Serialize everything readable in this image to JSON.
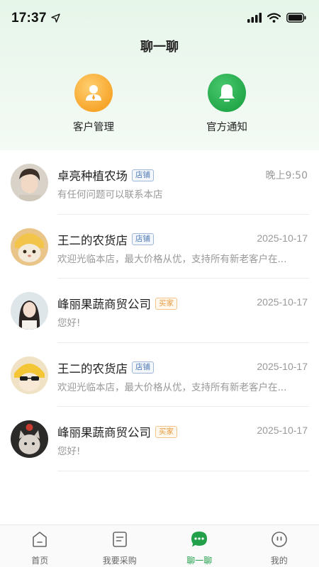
{
  "status_bar": {
    "time": "17:37",
    "icons": [
      "location-arrow-icon",
      "signal-icon",
      "wifi-icon",
      "battery-icon"
    ]
  },
  "header": {
    "title": "聊一聊"
  },
  "quick_actions": [
    {
      "label": "客户管理",
      "icon": "customer-person-icon",
      "color": "#f7a62c"
    },
    {
      "label": "官方通知",
      "icon": "bell-icon",
      "color": "#23a84a"
    }
  ],
  "tag_colors": {
    "shop": "#4d78b5",
    "buyer": "#e89a3c"
  },
  "chats": [
    {
      "name": "卓亮种植农场",
      "tag": "店铺",
      "time": "晚上9:50",
      "preview": "有任何问题可以联系本店"
    },
    {
      "name": "王二的农货店",
      "tag": "店铺",
      "time": "2025-10-17",
      "preview": "欢迎光临本店，最大价格从优，支持所有新老客户在..."
    },
    {
      "name": "峰丽果蔬商贸公司",
      "tag": "买家",
      "time": "2025-10-17",
      "preview": "您好!"
    },
    {
      "name": "王二的农货店",
      "tag": "店铺",
      "time": "2025-10-17",
      "preview": "欢迎光临本店，最大价格从优，支持所有新老客户在..."
    },
    {
      "name": "峰丽果蔬商贸公司",
      "tag": "买家",
      "time": "2025-10-17",
      "preview": "您好!"
    }
  ],
  "tabbar": {
    "active": "聊一聊",
    "active_color": "#22a04a",
    "items": [
      {
        "label": "首页",
        "icon": "home-icon"
      },
      {
        "label": "我要采购",
        "icon": "purchase-list-icon"
      },
      {
        "label": "聊一聊",
        "icon": "chat-bubble-icon"
      },
      {
        "label": "我的",
        "icon": "profile-icon"
      }
    ]
  }
}
